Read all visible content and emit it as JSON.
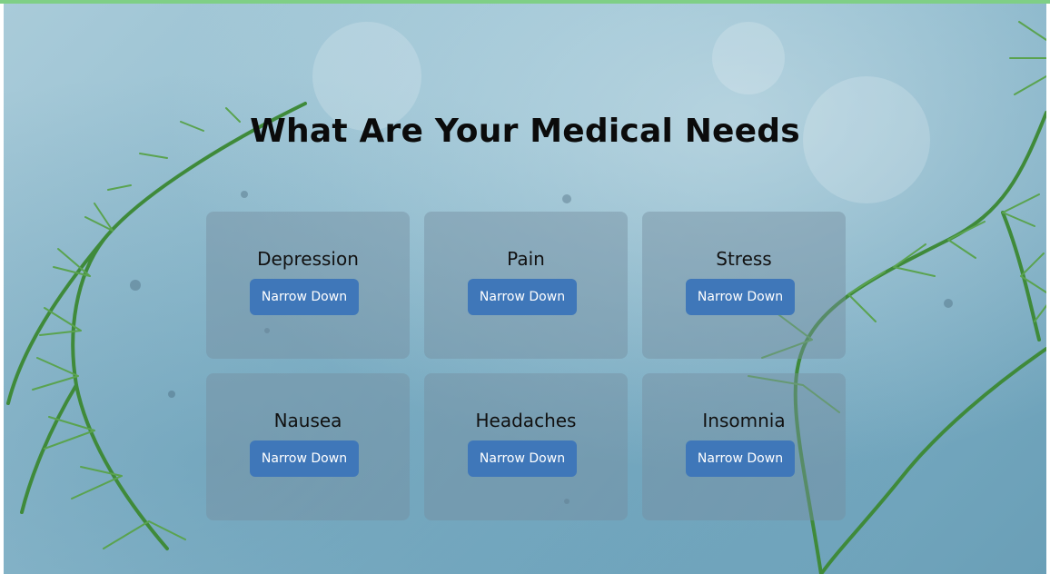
{
  "page": {
    "title": "What Are Your Medical Needs"
  },
  "colors": {
    "accent_bar": "#7fcf86",
    "button_bg": "#3f77b9",
    "button_text": "#ffffff",
    "card_bg": "rgba(118,142,160,0.45)",
    "title_text": "#0b0b0b"
  },
  "needs": [
    {
      "label": "Depression",
      "button": "Narrow Down"
    },
    {
      "label": "Pain",
      "button": "Narrow Down"
    },
    {
      "label": "Stress",
      "button": "Narrow Down"
    },
    {
      "label": "Nausea",
      "button": "Narrow Down"
    },
    {
      "label": "Headaches",
      "button": "Narrow Down"
    },
    {
      "label": "Insomnia",
      "button": "Narrow Down"
    }
  ]
}
